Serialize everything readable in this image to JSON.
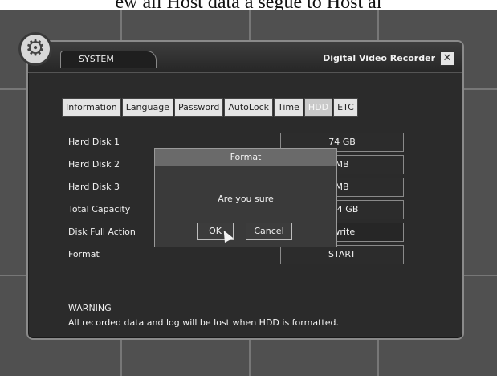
{
  "caption": "ew all Host data a segue to Host al",
  "window": {
    "tab_title": "SYSTEM",
    "app_title": "Digital Video Recorder",
    "close_glyph": "✕",
    "gear_glyph": "⚙"
  },
  "tabs": [
    {
      "label": "Information",
      "active": false
    },
    {
      "label": "Language",
      "active": false
    },
    {
      "label": "Password",
      "active": false
    },
    {
      "label": "AutoLock",
      "active": false
    },
    {
      "label": "Time",
      "active": false
    },
    {
      "label": "HDD",
      "active": true
    },
    {
      "label": "ETC",
      "active": false
    }
  ],
  "rows": [
    {
      "label": "Hard Disk 1",
      "value": "74 GB"
    },
    {
      "label": "Hard Disk 2",
      "value": "MB"
    },
    {
      "label": "Hard Disk 3",
      "value": "MB"
    },
    {
      "label": "Total Capacity",
      "value": "/ 74 GB"
    },
    {
      "label": "Disk Full Action",
      "value": "rwrite"
    },
    {
      "label": "Format",
      "value": "START"
    }
  ],
  "warning": {
    "title": "WARNING",
    "text": "All recorded data and log will be lost when HDD is formatted."
  },
  "dialog": {
    "title": "Format",
    "message": "Are you sure",
    "ok_label": "OK",
    "cancel_label": "Cancel"
  }
}
